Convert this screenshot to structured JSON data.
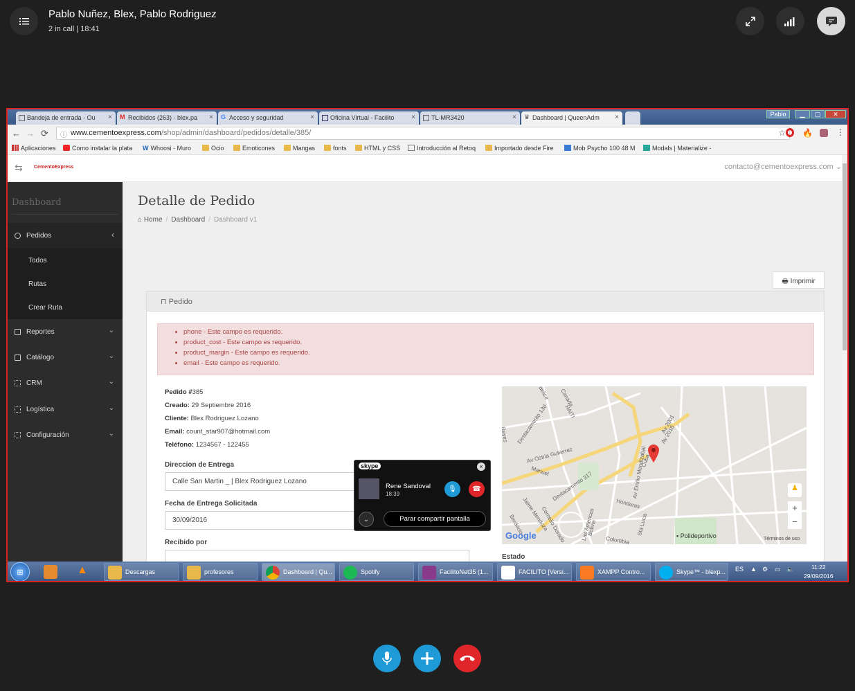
{
  "call": {
    "title": "Pablo Nuñez, Blex, Pablo Rodriguez",
    "status": "2 in call | 18:41"
  },
  "browser": {
    "tabs": [
      "Bandeja de entrada - Ou",
      "Recibidos (263) - blex.pa",
      "Acceso y seguridad",
      "Oficina Virtual - Facilito",
      "TL-MR3420",
      "Dashboard | QueenAdm"
    ],
    "profile": "Pablo",
    "url_host": "www.cementoexpress.com",
    "url_path": "/shop/admin/dashboard/pedidos/detalle/385/",
    "bookmarks": [
      "Aplicaciones",
      "Como instalar la plata",
      "Whoosi - Muro",
      "Ocio",
      "Emoticones",
      "Mangas",
      "fonts",
      "HTML y CSS",
      "Introducción al Retoq",
      "Importado desde Fire",
      "Mob Psycho 100 48 M",
      "Modals | Materialize -"
    ]
  },
  "app": {
    "brand": "CementoExpress",
    "account": "contacto@cementoexpress.com",
    "sidebar_title": "Dashboard",
    "menu": [
      {
        "label": "Pedidos"
      },
      {
        "label": "Reportes"
      },
      {
        "label": "Catálogo"
      },
      {
        "label": "CRM"
      },
      {
        "label": "Logística"
      },
      {
        "label": "Configuración"
      }
    ],
    "submenu": [
      "Todos",
      "Rutas",
      "Crear Ruta"
    ],
    "page_title": "Detalle de Pedido",
    "breadcrumb": [
      "Home",
      "Dashboard",
      "Dashboard v1"
    ],
    "print": "Imprimir",
    "panel_title": "Pedido",
    "errors": [
      "phone - Este campo es requerido.",
      "product_cost - Este campo es requerido.",
      "product_margin - Este campo es requerido.",
      "email - Este campo es requerido."
    ],
    "order": {
      "id_label": "Pedido #",
      "id": "385",
      "created_label": "Creado:",
      "created": "29 Septiembre 2016",
      "client_label": "Cliente:",
      "client": "Blex Rodriguez Lozano",
      "email_label": "Email:",
      "email": "count_star907@hotmail.com",
      "phone_label": "Teléfono:",
      "phone": "1234567 - 122455"
    },
    "fields": {
      "address_label": "Direccion de Entrega",
      "address": "Calle San Martin _ | Blex Rodriguez Lozano",
      "date_label": "Fecha de Entrega Solicitada",
      "date": "30/09/2016",
      "received_label": "Recibido por",
      "status_label": "Estado"
    },
    "map": {
      "streets": [
        "Av Ostria Gutierrez",
        "Destacamento 317",
        "Destacamento 130",
        "Av Emilio Mendizabal",
        "Av 2001",
        "Av 2016",
        "Honduras",
        "Cuba",
        "Manuel",
        "Jaime Mendoza",
        "Cornelio Dorado",
        "Las Americas",
        "Bolivia",
        "Sta Lucia",
        "Colombia",
        "Berdecio",
        "Reyes",
        "Canada",
        "HAITI",
        "delice"
      ],
      "place": "Polideportivo",
      "brand": "Google",
      "terms": "Términos de uso"
    }
  },
  "skype_popup": {
    "logo": "skype",
    "caller": "Rene Sandoval",
    "time": "18:39",
    "stop_share": "Parar compartir pantalla"
  },
  "taskbar": {
    "items": [
      "Descargas",
      "profesores",
      "Dashboard | Qu...",
      "Spotify",
      "FacilitoNet35 (1...",
      "FACILITO [Versi...",
      "XAMPP Contro...",
      "Skype™ - blexp..."
    ],
    "lang": "ES",
    "time": "11:22",
    "date": "29/09/2016"
  },
  "colors": {
    "accent": "#1e9bd7",
    "hangup": "#e0262a",
    "sidebar": "#2c2c2c"
  }
}
